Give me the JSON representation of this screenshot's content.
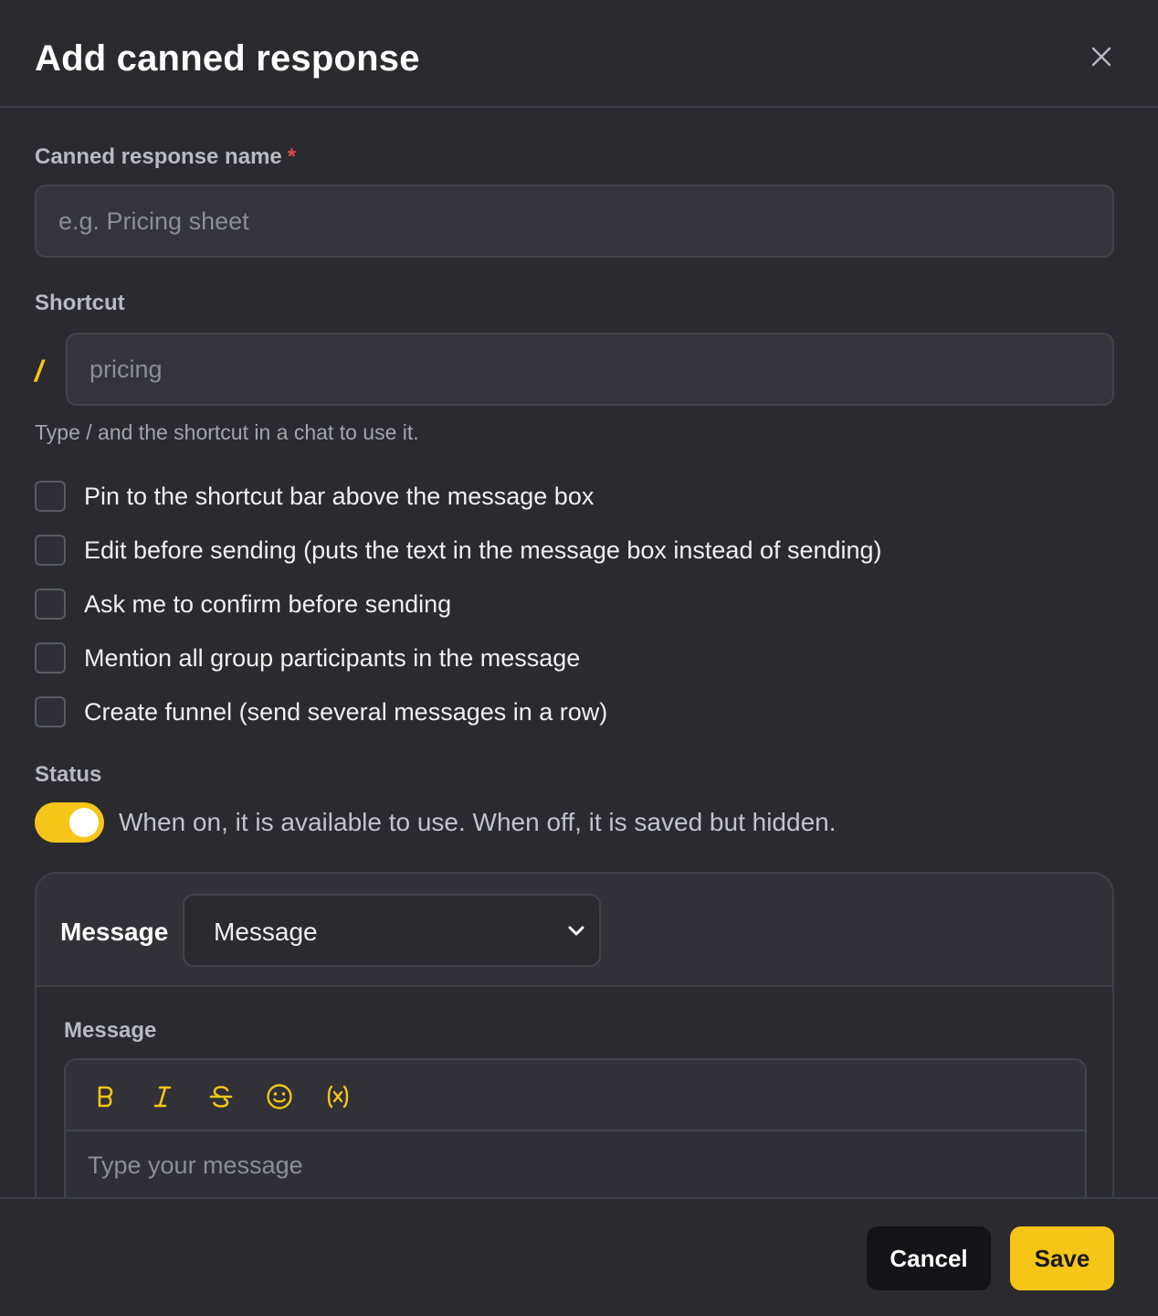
{
  "dialog": {
    "title": "Add canned response",
    "close_icon": "close-icon"
  },
  "name_field": {
    "label": "Canned response name",
    "required_mark": "*",
    "placeholder": "e.g. Pricing sheet",
    "value": ""
  },
  "shortcut_field": {
    "label": "Shortcut",
    "prefix": "/",
    "placeholder": "pricing",
    "value": "",
    "hint": "Type / and the shortcut in a chat to use it."
  },
  "options": [
    {
      "label": "Pin to the shortcut bar above the message box",
      "checked": false
    },
    {
      "label": "Edit before sending (puts the text in the message box instead of sending)",
      "checked": false
    },
    {
      "label": "Ask me to confirm before sending",
      "checked": false
    },
    {
      "label": "Mention all group participants in the message",
      "checked": false
    },
    {
      "label": "Create funnel (send several messages in a row)",
      "checked": false
    }
  ],
  "status": {
    "label": "Status",
    "enabled": true,
    "description": "When on, it is available to use. When off, it is saved but hidden."
  },
  "message_block": {
    "type_label": "Message",
    "selected_type": "Message",
    "editor_label": "Message",
    "toolbar_icons": [
      "bold-icon",
      "italic-icon",
      "strikethrough-icon",
      "emoji-icon",
      "variable-icon"
    ],
    "placeholder": "Type your message",
    "value": ""
  },
  "footer": {
    "cancel_label": "Cancel",
    "save_label": "Save"
  },
  "colors": {
    "accent": "#f5c518",
    "background": "#2a2a2f",
    "required": "#e5484d"
  }
}
